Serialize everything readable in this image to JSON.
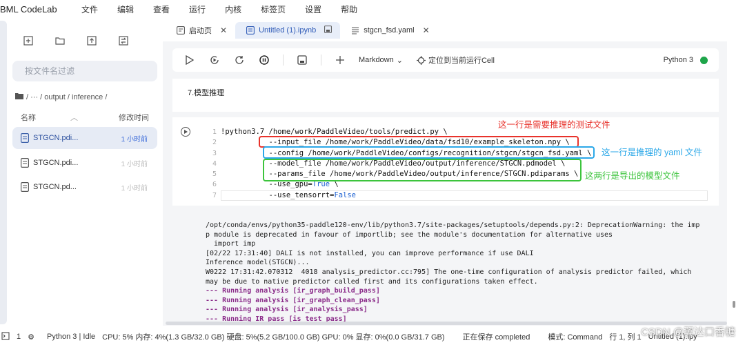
{
  "app": {
    "title": "BML CodeLab"
  },
  "menu": [
    "文件",
    "编辑",
    "查看",
    "运行",
    "内核",
    "标签页",
    "设置",
    "帮助"
  ],
  "sidebar": {
    "filter_placeholder": "按文件名过滤",
    "breadcrumb": "/ ··· / output / inference /",
    "columns": {
      "name": "名称",
      "modified": "修改时间"
    },
    "files": [
      {
        "name": "STGCN.pdi...",
        "time": "1 小时前",
        "active": true
      },
      {
        "name": "STGCN.pdi...",
        "time": "1 小时前",
        "active": false
      },
      {
        "name": "STGCN.pd...",
        "time": "1 小时前",
        "active": false
      }
    ]
  },
  "tabs": [
    {
      "label": "启动页",
      "active": false
    },
    {
      "label": "Untitled (1).ipynb",
      "active": true
    },
    {
      "label": "stgcn_fsd.yaml",
      "active": false
    }
  ],
  "toolbar": {
    "cell_type": "Markdown",
    "locate": "定位到当前运行Cell",
    "kernel": "Python 3",
    "kernel_status_color": "#1ea54a"
  },
  "markdown_cell": {
    "text": "7.模型推理"
  },
  "code_cell": {
    "line_numbers": [
      "1",
      "2",
      "3",
      "4",
      "5",
      "6",
      "7"
    ],
    "lines": [
      "!python3.7 /home/work/PaddleVideo/tools/predict.py \\",
      "           --input_file /home/work/PaddleVideo/data/fsd10/example_skeleton.npy \\",
      "           --config /home/work/PaddleVideo/configs/recognition/stgcn/stgcn_fsd.yaml \\",
      "           --model_file /home/work/PaddleVideo/output/inference/STGCN.pdmodel \\",
      "           --params_file /home/work/PaddleVideo/output/inference/STGCN.pdiparams \\",
      "           --use_gpu=",
      "           --use_tensorrt="
    ],
    "gpu_value": "True",
    "trt_value": "False",
    "gpu_tail": " \\"
  },
  "annotations": [
    {
      "text": "这一行是需要推理的测试文件",
      "color": "#e8322b"
    },
    {
      "text": "这一行是推理的 yaml 文件",
      "color": "#2aa7e8"
    },
    {
      "text": "这两行是导出的模型文件",
      "color": "#3cc43c"
    }
  ],
  "output": [
    {
      "text": "/opt/conda/envs/python35-paddle120-env/lib/python3.7/site-packages/setuptools/depends.py:2: DeprecationWarning: the imp",
      "style": "normal"
    },
    {
      "text": "p module is deprecated in favour of importlib; see the module's documentation for alternative uses",
      "style": "normal"
    },
    {
      "text": "  import imp",
      "style": "normal"
    },
    {
      "text": "[02/22 17:31:40] DALI is not installed, you can improve performance if use DALI",
      "style": "normal"
    },
    {
      "text": "Inference model(STGCN)...",
      "style": "normal"
    },
    {
      "text": "W0222 17:31:42.070312  4018 analysis_predictor.cc:795] The one-time configuration of analysis predictor failed, which",
      "style": "normal"
    },
    {
      "text": "may be due to native predictor called first and its configurations taken effect.",
      "style": "normal"
    },
    {
      "text": "--- Running analysis [ir_graph_build_pass]",
      "style": "purple"
    },
    {
      "text": "--- Running analysis [ir_graph_clean_pass]",
      "style": "purple"
    },
    {
      "text": "--- Running analysis [ir_analysis_pass]",
      "style": "purple"
    },
    {
      "text": "--- Running IR pass [is_test_pass]",
      "style": "purple"
    }
  ],
  "status": {
    "count": "1",
    "kernel": "Python 3 | Idle",
    "cpu": "CPU:  5% 内存: 4%(1.3 GB/32.0 GB) 硬盘: 5%(5.2 GB/100.0 GB) GPU:  0%  显存: 0%(0.0 GB/31.7 GB)",
    "saving": "正在保存 completed",
    "mode": "模式: Command",
    "position": "行 1, 列 1",
    "file": "Untitled (1).ipy"
  },
  "watermark": "CSDN @翼达口香糖"
}
